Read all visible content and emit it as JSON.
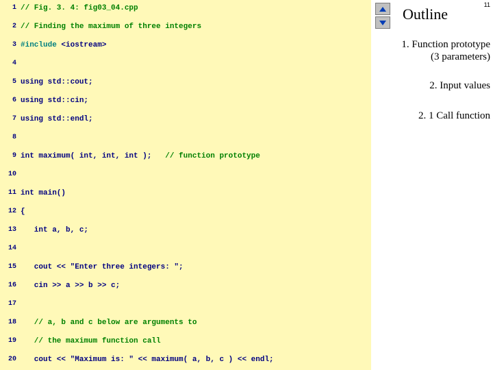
{
  "sidebar": {
    "title": "Outline",
    "page_number": "11",
    "sections": [
      "1.  Function prototype\n(3 parameters)",
      "2.  Input values",
      "2. 1  Call function"
    ]
  },
  "code": {
    "lines": [
      {
        "n": "1",
        "tokens": [
          {
            "t": "// Fig. 3. 4: fig03_04.cpp",
            "c": "cmt"
          }
        ]
      },
      {
        "n": "2",
        "tokens": [
          {
            "t": "// Finding the maximum of three integers",
            "c": "cmt"
          }
        ]
      },
      {
        "n": "3",
        "tokens": [
          {
            "t": "#include ",
            "c": "pre"
          },
          {
            "t": "<iostream>",
            "c": "kw"
          }
        ]
      },
      {
        "n": "4",
        "tokens": []
      },
      {
        "n": "5",
        "tokens": [
          {
            "t": "using std::cout;",
            "c": "kw"
          }
        ]
      },
      {
        "n": "6",
        "tokens": [
          {
            "t": "using std::cin;",
            "c": "kw"
          }
        ]
      },
      {
        "n": "7",
        "tokens": [
          {
            "t": "using std::endl;",
            "c": "kw"
          }
        ]
      },
      {
        "n": "8",
        "tokens": []
      },
      {
        "n": "9",
        "tokens": [
          {
            "t": "int maximum( int, int, int );   ",
            "c": "kw"
          },
          {
            "t": "// function prototype",
            "c": "cmt"
          }
        ]
      },
      {
        "n": "10",
        "tokens": []
      },
      {
        "n": "11",
        "tokens": [
          {
            "t": "int main()",
            "c": "kw"
          }
        ]
      },
      {
        "n": "12",
        "tokens": [
          {
            "t": "{",
            "c": "kw"
          }
        ]
      },
      {
        "n": "13",
        "tokens": [
          {
            "t": "   int a, b, c;",
            "c": "kw"
          }
        ]
      },
      {
        "n": "14",
        "tokens": []
      },
      {
        "n": "15",
        "tokens": [
          {
            "t": "   cout << \"Enter three integers: \";",
            "c": "kw"
          }
        ]
      },
      {
        "n": "16",
        "tokens": [
          {
            "t": "   cin >> a >> b >> c;",
            "c": "kw"
          }
        ]
      },
      {
        "n": "17",
        "tokens": []
      },
      {
        "n": "18",
        "tokens": [
          {
            "t": "   // a, b and c below are arguments to",
            "c": "cmt"
          }
        ]
      },
      {
        "n": "19",
        "tokens": [
          {
            "t": "   // the maximum function call",
            "c": "cmt"
          }
        ]
      },
      {
        "n": "20",
        "tokens": [
          {
            "t": "   cout << \"Maximum is: \" << maximum( a, b, c ) << endl;",
            "c": "kw"
          }
        ]
      }
    ]
  }
}
